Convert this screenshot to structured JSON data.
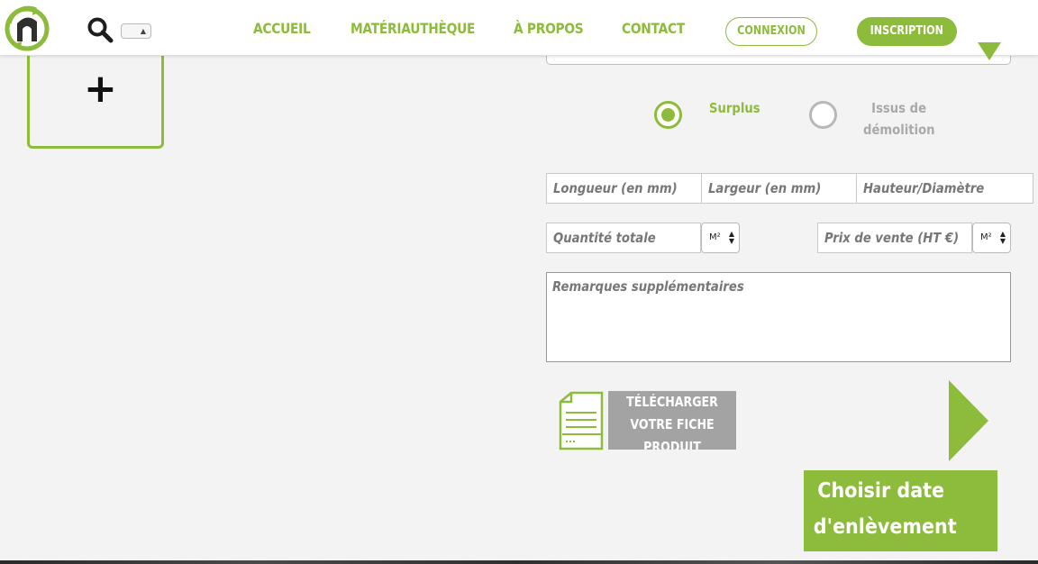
{
  "nav": {
    "items": [
      {
        "label": "ACCUEIL"
      },
      {
        "label": "MATÉRIAUTHÈQUE"
      },
      {
        "label": "À PROPOS"
      },
      {
        "label": "CONTACT"
      }
    ],
    "connexion_label": "CONNEXION",
    "inscription_label": "INSCRIPTION"
  },
  "form": {
    "origin": {
      "options": [
        {
          "label": "Surplus",
          "selected": true
        },
        {
          "label": "Issus de démolition",
          "selected": false
        }
      ]
    },
    "dimensions": {
      "length_placeholder": "Longueur (en mm)",
      "width_placeholder": "Largeur (en mm)",
      "height_placeholder": "Hauteur/Diamètre"
    },
    "quantity_placeholder": "Quantité totale",
    "quantity_unit": "M²",
    "price_placeholder": "Prix de vente (HT €)",
    "price_unit": "M²",
    "remarks_placeholder": "Remarques supplémentaires"
  },
  "download": {
    "label": "TÉLÉCHARGER VOTRE FICHE PRODUIT"
  },
  "next": {
    "date_line1": "Choisir date",
    "date_line2": "d'enlèvement"
  },
  "colors": {
    "accent": "#8dbb3b",
    "muted": "#a3a3a3",
    "background": "#f3f3f3"
  }
}
